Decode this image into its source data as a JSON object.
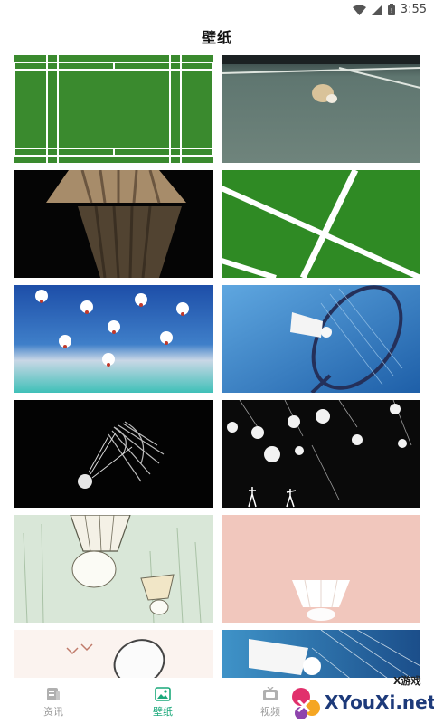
{
  "status": {
    "time": "3:55"
  },
  "header": {
    "title": "壁纸"
  },
  "wallpapers": [
    {
      "name": "badminton-court-top-view"
    },
    {
      "name": "shuttlecock-on-court"
    },
    {
      "name": "shuttlecock-reflection-dark"
    },
    {
      "name": "court-lines-green"
    },
    {
      "name": "shuttlecocks-in-arena"
    },
    {
      "name": "racket-and-shuttle-blue"
    },
    {
      "name": "glowing-shuttle-black"
    },
    {
      "name": "falling-shuttles-night"
    },
    {
      "name": "illustrated-shuttles-grass"
    },
    {
      "name": "shuttle-pink-background"
    },
    {
      "name": "racket-birds-illustration"
    },
    {
      "name": "racket-shuttle-closeup"
    }
  ],
  "bottom_nav": {
    "items": [
      {
        "label": "资讯",
        "icon": "news-icon",
        "active": false
      },
      {
        "label": "壁纸",
        "icon": "image-icon",
        "active": true
      },
      {
        "label": "视频",
        "icon": "tv-icon",
        "active": false
      }
    ]
  },
  "watermark": {
    "brand": "XYouXi.net",
    "tag": "X游戏"
  },
  "colors": {
    "accent": "#1aa87a",
    "inactive": "#9a9a9a"
  }
}
